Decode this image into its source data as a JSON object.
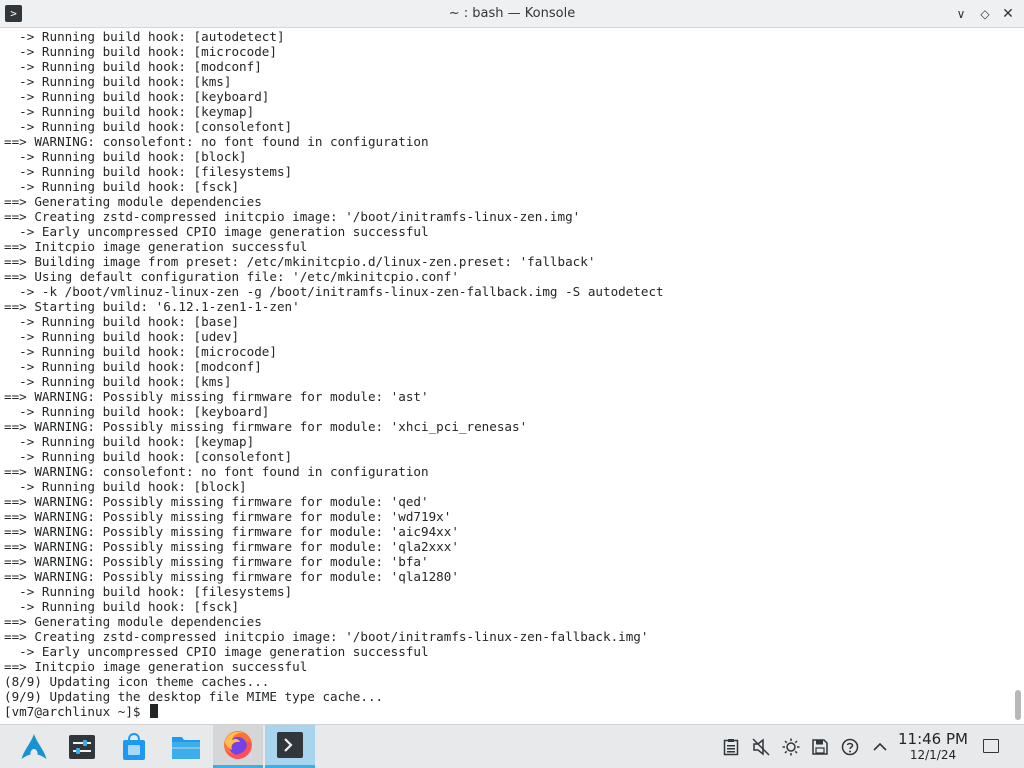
{
  "window": {
    "title": "~ : bash — Konsole",
    "app_icon_glyph": ">",
    "minimize_glyph": "∨",
    "maximize_glyph": "◇",
    "close_glyph": "✕"
  },
  "terminal": {
    "lines": [
      "  -> Running build hook: [autodetect]",
      "  -> Running build hook: [microcode]",
      "  -> Running build hook: [modconf]",
      "  -> Running build hook: [kms]",
      "  -> Running build hook: [keyboard]",
      "  -> Running build hook: [keymap]",
      "  -> Running build hook: [consolefont]",
      "==> WARNING: consolefont: no font found in configuration",
      "  -> Running build hook: [block]",
      "  -> Running build hook: [filesystems]",
      "  -> Running build hook: [fsck]",
      "==> Generating module dependencies",
      "==> Creating zstd-compressed initcpio image: '/boot/initramfs-linux-zen.img'",
      "  -> Early uncompressed CPIO image generation successful",
      "==> Initcpio image generation successful",
      "==> Building image from preset: /etc/mkinitcpio.d/linux-zen.preset: 'fallback'",
      "==> Using default configuration file: '/etc/mkinitcpio.conf'",
      "  -> -k /boot/vmlinuz-linux-zen -g /boot/initramfs-linux-zen-fallback.img -S autodetect",
      "==> Starting build: '6.12.1-zen1-1-zen'",
      "  -> Running build hook: [base]",
      "  -> Running build hook: [udev]",
      "  -> Running build hook: [microcode]",
      "  -> Running build hook: [modconf]",
      "  -> Running build hook: [kms]",
      "==> WARNING: Possibly missing firmware for module: 'ast'",
      "  -> Running build hook: [keyboard]",
      "==> WARNING: Possibly missing firmware for module: 'xhci_pci_renesas'",
      "  -> Running build hook: [keymap]",
      "  -> Running build hook: [consolefont]",
      "==> WARNING: consolefont: no font found in configuration",
      "  -> Running build hook: [block]",
      "==> WARNING: Possibly missing firmware for module: 'qed'",
      "==> WARNING: Possibly missing firmware for module: 'wd719x'",
      "==> WARNING: Possibly missing firmware for module: 'aic94xx'",
      "==> WARNING: Possibly missing firmware for module: 'qla2xxx'",
      "==> WARNING: Possibly missing firmware for module: 'bfa'",
      "==> WARNING: Possibly missing firmware for module: 'qla1280'",
      "  -> Running build hook: [filesystems]",
      "  -> Running build hook: [fsck]",
      "==> Generating module dependencies",
      "==> Creating zstd-compressed initcpio image: '/boot/initramfs-linux-zen-fallback.img'",
      "  -> Early uncompressed CPIO image generation successful",
      "==> Initcpio image generation successful",
      "(8/9) Updating icon theme caches...",
      "(9/9) Updating the desktop file MIME type cache..."
    ],
    "prompt": "[vm7@archlinux ~]$ "
  },
  "taskbar": {
    "launcher_icon": "arch-linux-logo-icon",
    "tasks": [
      {
        "name": "system-settings-icon"
      },
      {
        "name": "discover-store-icon"
      },
      {
        "name": "dolphin-file-manager-icon"
      },
      {
        "name": "firefox-icon"
      },
      {
        "name": "konsole-icon"
      }
    ],
    "tray": [
      {
        "name": "clipboard-icon",
        "glyph": "▤"
      },
      {
        "name": "volume-muted-icon",
        "glyph": "🔇"
      },
      {
        "name": "brightness-icon",
        "glyph": "☼"
      },
      {
        "name": "disk-icon",
        "glyph": "💾"
      },
      {
        "name": "help-icon",
        "glyph": "?"
      },
      {
        "name": "expand-tray-icon",
        "glyph": "∧"
      }
    ],
    "clock": {
      "time": "11:46 PM",
      "date": "12/1/24"
    }
  },
  "colors": {
    "accent": "#3daee9",
    "terminal_bg": "#ffffff",
    "terminal_fg": "#232627",
    "panel_bg": "#e8e9ea"
  }
}
